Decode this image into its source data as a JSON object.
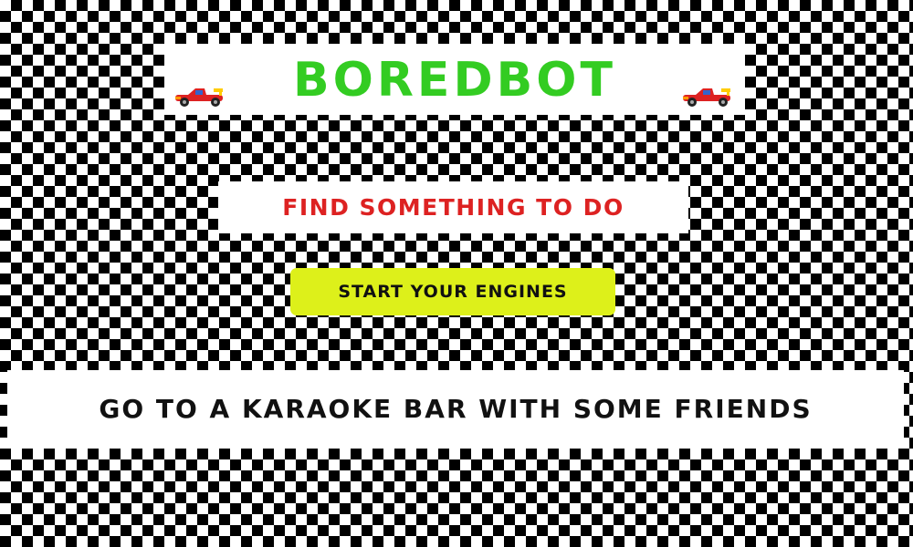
{
  "header": {
    "title": "BOREDBOT",
    "title_color": "#33cc22",
    "left_icon": "race-car-icon",
    "right_icon": "race-car-icon"
  },
  "subtitle": {
    "text": "FIND SOMETHING TO DO",
    "color": "#dd2222"
  },
  "start_button": {
    "label": "START YOUR ENGINES",
    "color": "#ddf01a"
  },
  "result": {
    "text": "GO TO A KARAOKE BAR WITH SOME FRIENDS"
  },
  "background": {
    "pattern": "checkered-flag",
    "colors": [
      "#000000",
      "#ffffff"
    ]
  }
}
